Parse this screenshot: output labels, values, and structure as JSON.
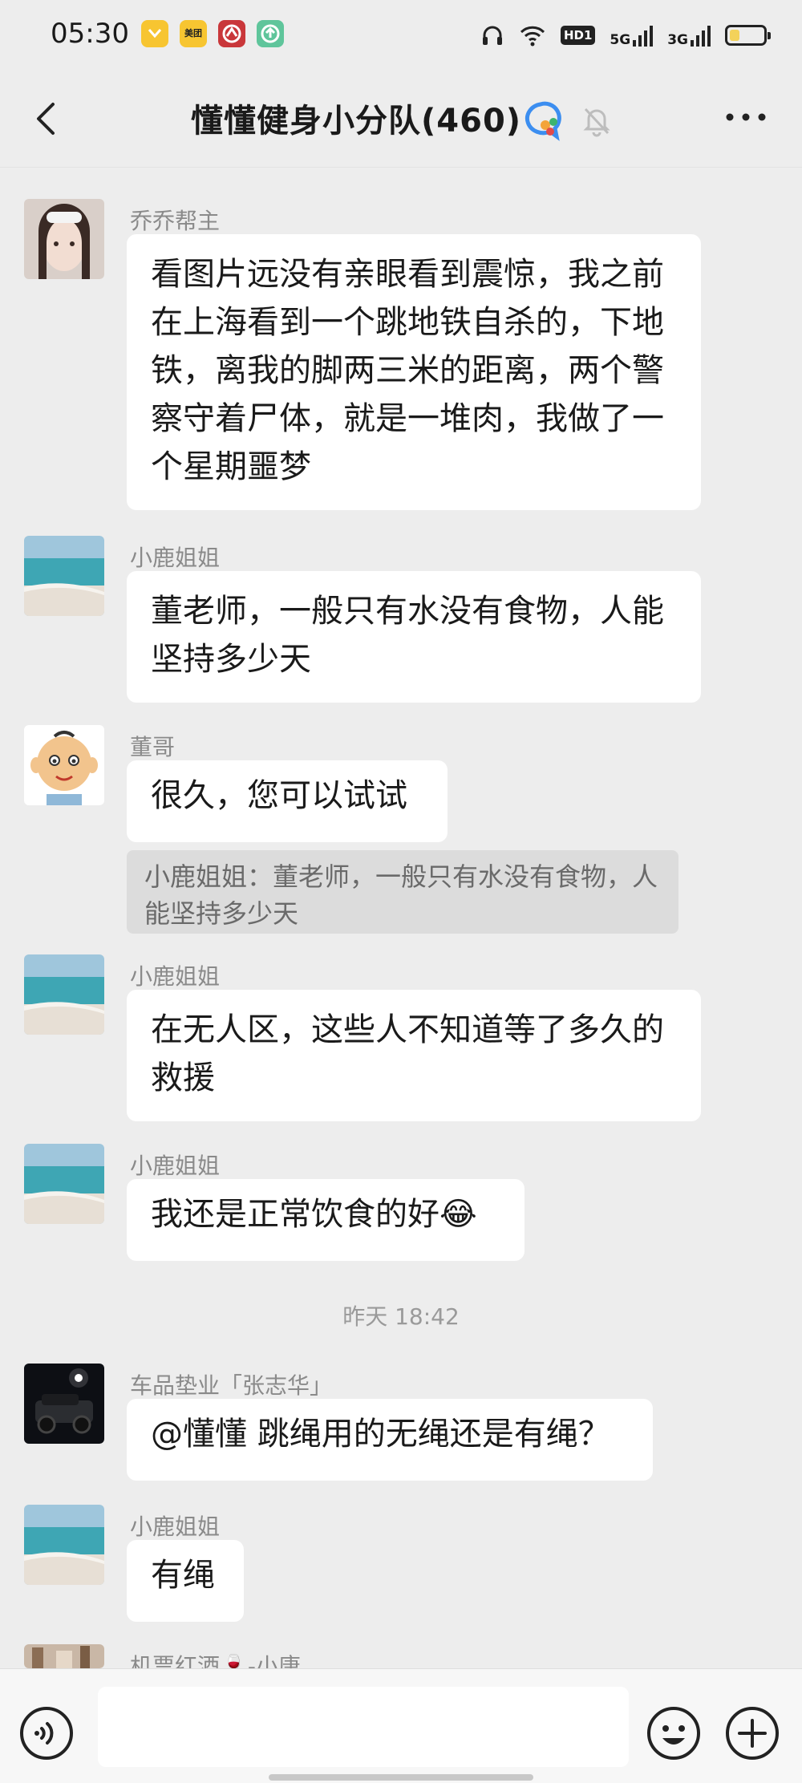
{
  "status_bar": {
    "time": "05:30",
    "app_icons": [
      {
        "name": "coupon-app-icon",
        "color": "#f7c531",
        "label": ""
      },
      {
        "name": "meituan-app-icon",
        "color": "#f7c531",
        "label": "美团"
      },
      {
        "name": "bank-app-icon",
        "color": "#c9373a",
        "label": ""
      },
      {
        "name": "green-app-icon",
        "color": "#5fc59b",
        "label": ""
      }
    ],
    "hd_label": "HD1",
    "network_1": "5G",
    "network_2": "3G",
    "battery_percent": 30
  },
  "header": {
    "title": "懂懂健身小分队(460)"
  },
  "messages": [
    {
      "sender": "乔乔帮主",
      "text": "看图片远没有亲眼看到震惊，我之前在上海看到一个跳地铁自杀的，下地铁，离我的脚两三米的距离，两个警察守着尸体，就是一堆肉，我做了一个星期噩梦"
    },
    {
      "sender": "小鹿姐姐",
      "text": "董老师，一般只有水没有食物，人能坚持多少天"
    },
    {
      "sender": "董哥",
      "text": "很久，您可以试试",
      "quote": "小鹿姐姐：董老师，一般只有水没有食物，人能坚持多少天"
    },
    {
      "sender": "小鹿姐姐",
      "text": "在无人区，这些人不知道等了多久的救援"
    },
    {
      "sender": "小鹿姐姐",
      "text": "我还是正常饮食的好",
      "emoji": "😂"
    },
    {
      "sender": "车品垫业「张志华」",
      "text": "@懂懂  跳绳用的无绳还是有绳？"
    },
    {
      "sender": "小鹿姐姐",
      "text": "有绳"
    },
    {
      "sender": "机票红酒🍷-小唐",
      "text": ""
    }
  ],
  "timestamp": "昨天 18:42",
  "input": {
    "placeholder": ""
  },
  "colors": {
    "background": "#ededed",
    "bubble": "#ffffff",
    "quote_bg": "#dcdcdc",
    "sender": "#8a8a8a"
  }
}
